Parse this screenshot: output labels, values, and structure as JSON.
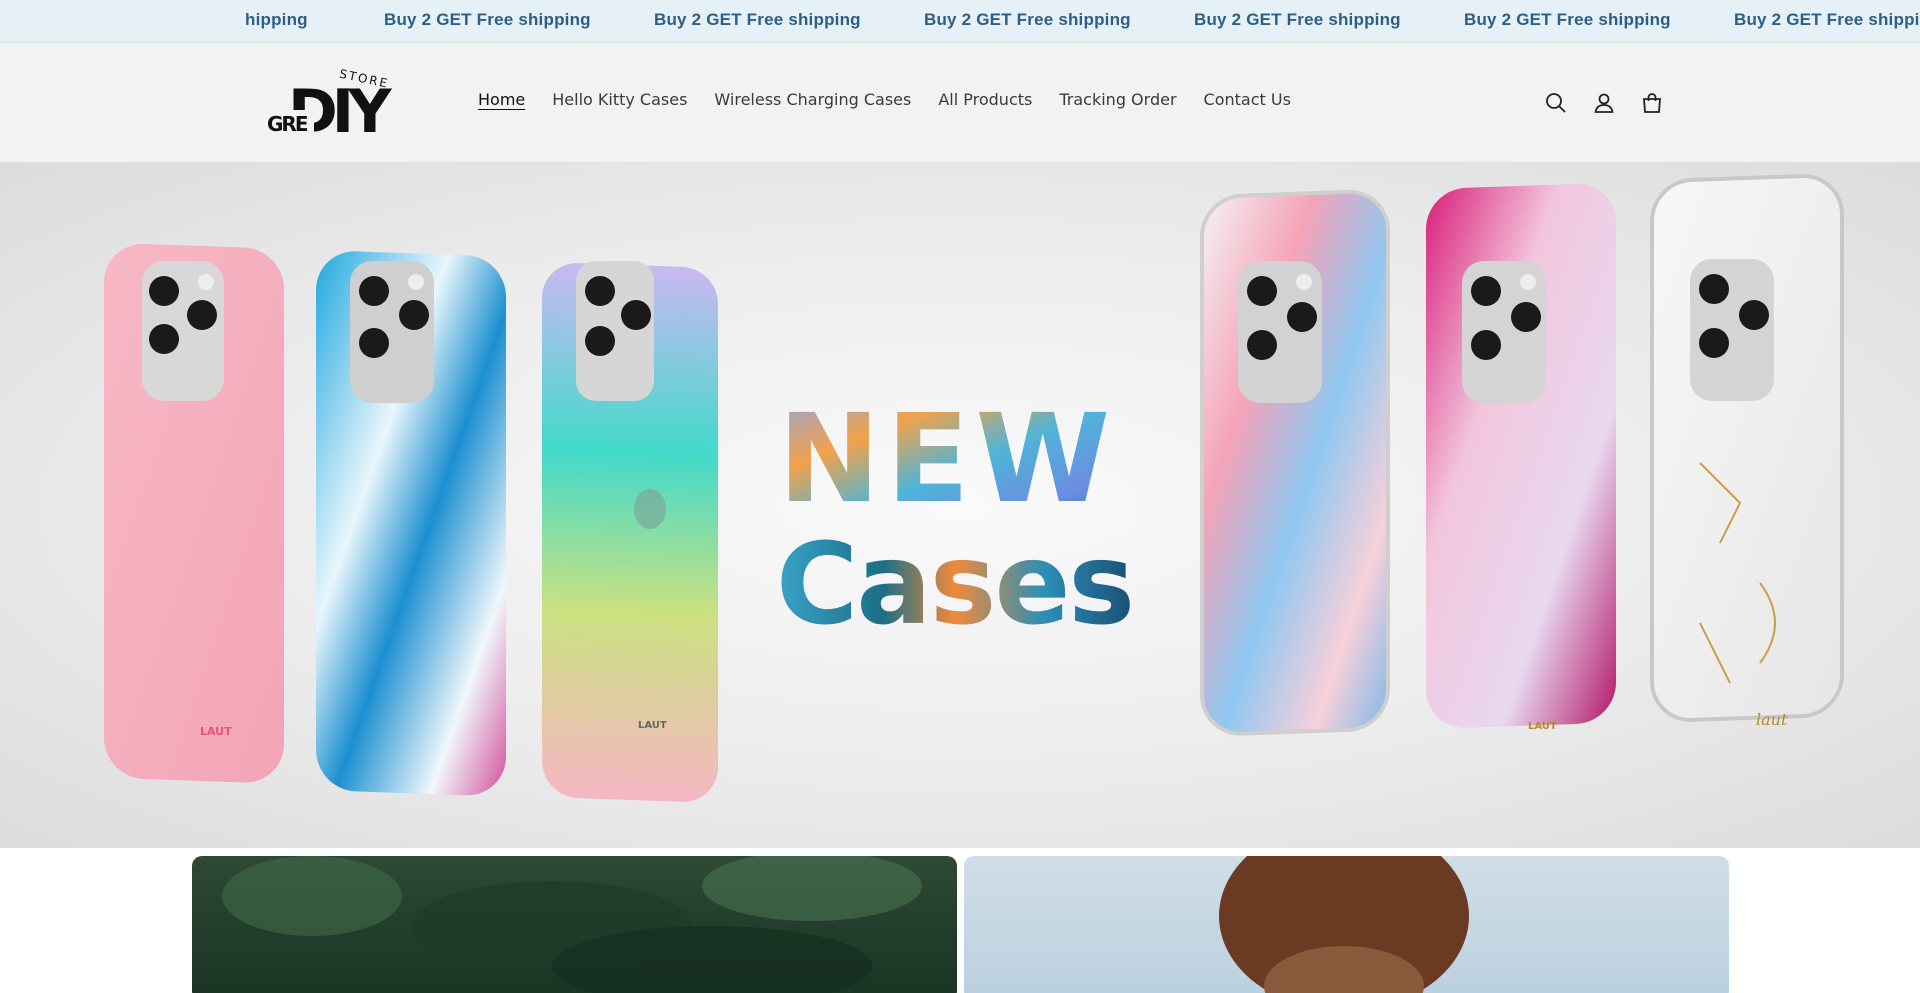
{
  "announcement": {
    "partial_text": "hipping",
    "message": "Buy 2 GET Free shipping",
    "message_partial_end": "Buy 2 GET Free shippin"
  },
  "logo": {
    "text_top": "STORE",
    "text_big": "DIY",
    "text_small": "GRE"
  },
  "nav": {
    "items": [
      {
        "label": "Home",
        "active": true
      },
      {
        "label": "Hello Kitty Cases",
        "active": false
      },
      {
        "label": "Wireless Charging Cases",
        "active": false
      },
      {
        "label": "All Products",
        "active": false
      },
      {
        "label": "Tracking Order",
        "active": false
      },
      {
        "label": "Contact Us",
        "active": false
      }
    ]
  },
  "header_icons": [
    "search-icon",
    "account-icon",
    "cart-icon"
  ],
  "hero": {
    "line1": "NEW",
    "line2": "Cases",
    "phone_brand": "LAUT",
    "phone_brand_script": "laut"
  },
  "colors": {
    "announcement_bg": "#e6f1f7",
    "announcement_text": "#2d5f86",
    "header_bg": "#f2f2f2"
  }
}
